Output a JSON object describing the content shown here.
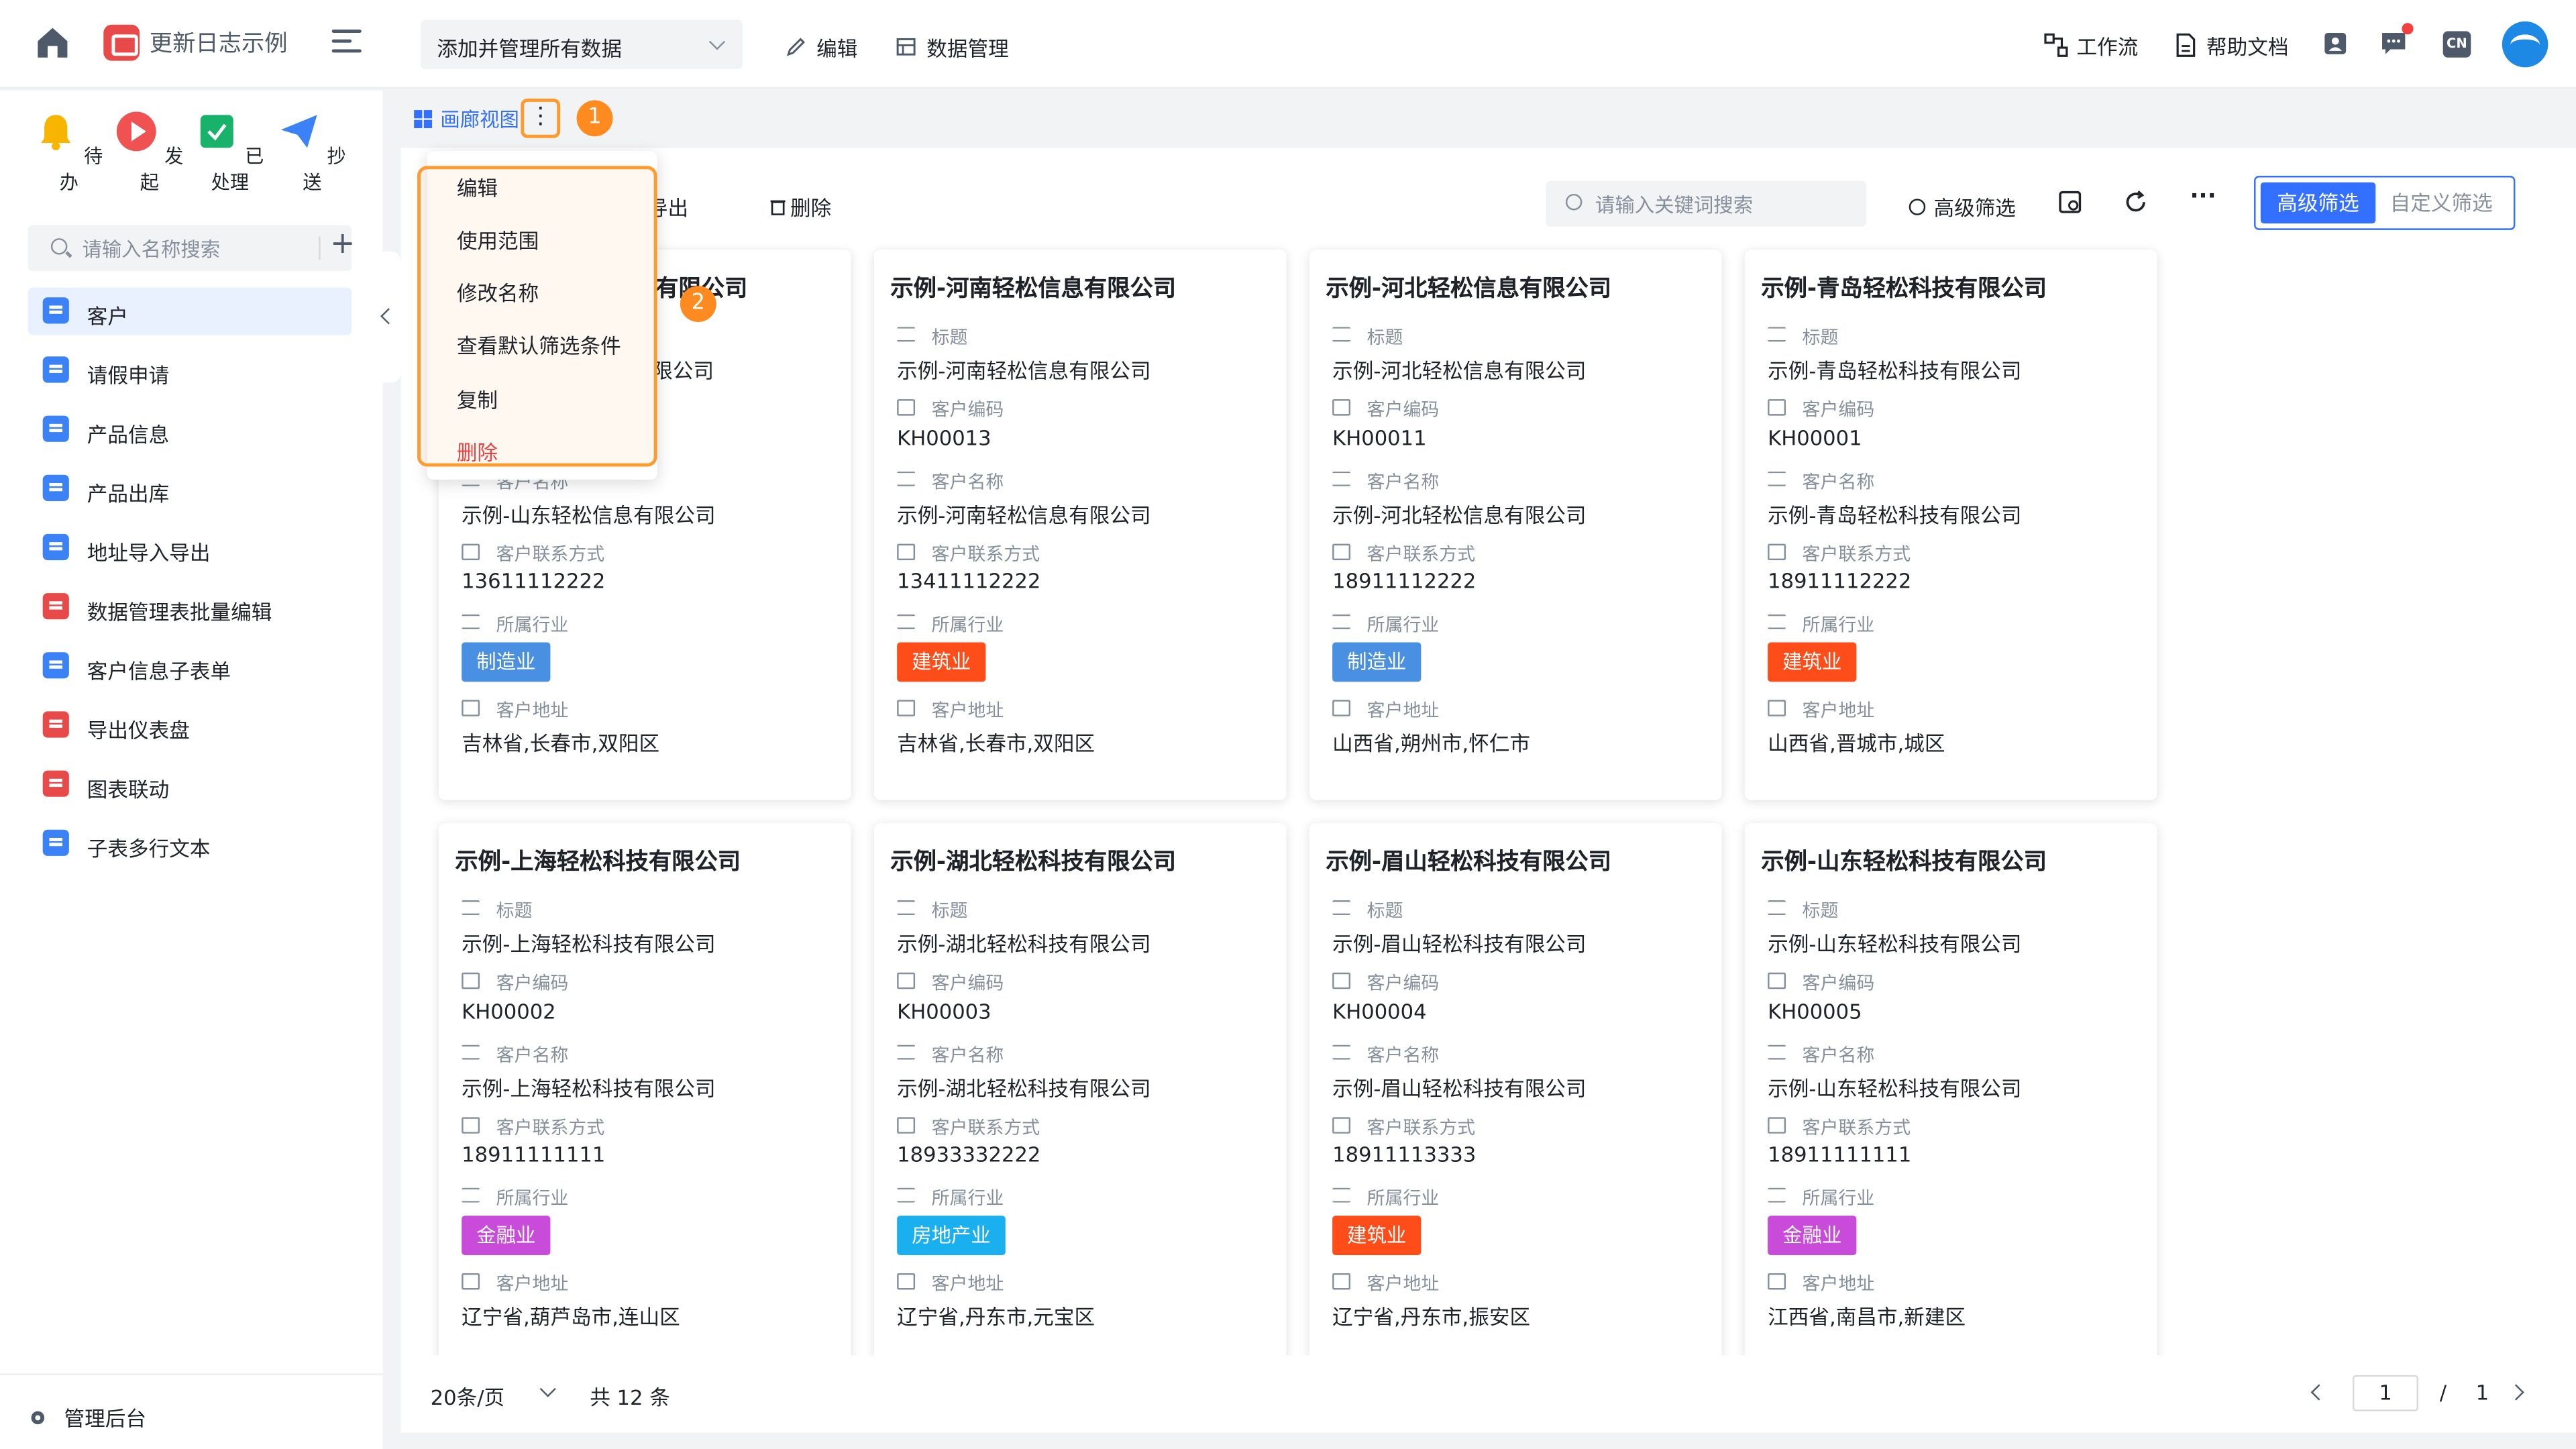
{
  "header": {
    "app_title": "更新日志示例",
    "dataset": "添加并管理所有数据",
    "edit": "编辑",
    "data_manage": "数据管理",
    "workflow": "工作流",
    "help": "帮助文档",
    "lang": "CN"
  },
  "sidebar": {
    "quick": [
      {
        "label": "待办",
        "icon": "bell-icon",
        "color": "#f7b500"
      },
      {
        "label": "发起",
        "icon": "play-icon",
        "color": "#f05252"
      },
      {
        "label": "已处理",
        "icon": "check-doc-icon",
        "color": "#19b26b"
      },
      {
        "label": "抄送",
        "icon": "send-icon",
        "color": "#3b82f6"
      }
    ],
    "search_placeholder": "请输入名称搜索",
    "items": [
      {
        "label": "客户",
        "color": "blue",
        "active": true
      },
      {
        "label": "请假申请",
        "color": "blue"
      },
      {
        "label": "产品信息",
        "color": "blue"
      },
      {
        "label": "产品出库",
        "color": "blue"
      },
      {
        "label": "地址导入导出",
        "color": "blue"
      },
      {
        "label": "数据管理表批量编辑",
        "color": "red"
      },
      {
        "label": "客户信息子表单",
        "color": "blue"
      },
      {
        "label": "导出仪表盘",
        "color": "red"
      },
      {
        "label": "图表联动",
        "color": "red"
      },
      {
        "label": "子表多行文本",
        "color": "blue"
      }
    ],
    "admin": "管理后台"
  },
  "view": {
    "tab_label": "画廊视图",
    "badge1": "1",
    "badge2": "2"
  },
  "dropdown": [
    "编辑",
    "使用范围",
    "修改名称",
    "查看默认筛选条件",
    "复制",
    "删除"
  ],
  "toolbar": {
    "export": "导出",
    "delete": "删除",
    "search_placeholder": "请输入关键词搜索",
    "advanced_filter": "高级筛选",
    "seg_on": "高级筛选",
    "seg_off": "自定义筛选",
    "more": "···"
  },
  "field_labels": {
    "title": "标题",
    "code": "客户编码",
    "name": "客户名称",
    "contact": "客户联系方式",
    "industry": "所属行业",
    "address": "客户地址"
  },
  "cards": [
    {
      "title": "示例-山东轻松信息有限公司",
      "title_visible": "有限公司",
      "name_partial": "限公司",
      "contact": "13611112222",
      "industry": "制造业",
      "tag_color": "#4a90e2",
      "address": "吉林省,长春市,双阳区",
      "name": "示例-山东轻松信息有限公司"
    },
    {
      "title": "示例-河南轻松信息有限公司",
      "name": "示例-河南轻松信息有限公司",
      "code": "KH00013",
      "contact": "13411112222",
      "industry": "建筑业",
      "tag_color": "#ff4d1a",
      "address": "吉林省,长春市,双阳区"
    },
    {
      "title": "示例-河北轻松信息有限公司",
      "name": "示例-河北轻松信息有限公司",
      "code": "KH00011",
      "contact": "18911112222",
      "industry": "制造业",
      "tag_color": "#4a90e2",
      "address": "山西省,朔州市,怀仁市"
    },
    {
      "title": "示例-青岛轻松科技有限公司",
      "name": "示例-青岛轻松科技有限公司",
      "code": "KH00001",
      "contact": "18911112222",
      "industry": "建筑业",
      "tag_color": "#ff4d1a",
      "address": "山西省,晋城市,城区"
    },
    {
      "title": "示例-上海轻松科技有限公司",
      "name": "示例-上海轻松科技有限公司",
      "code": "KH00002",
      "contact": "18911111111",
      "industry": "金融业",
      "tag_color": "#c84bd9",
      "address": "辽宁省,葫芦岛市,连山区"
    },
    {
      "title": "示例-湖北轻松科技有限公司",
      "name": "示例-湖北轻松科技有限公司",
      "code": "KH00003",
      "contact": "18933332222",
      "industry": "房地产业",
      "tag_color": "#1ab0f0",
      "address": "辽宁省,丹东市,元宝区"
    },
    {
      "title": "示例-眉山轻松科技有限公司",
      "name": "示例-眉山轻松科技有限公司",
      "code": "KH00004",
      "contact": "18911113333",
      "industry": "建筑业",
      "tag_color": "#ff4d1a",
      "address": "辽宁省,丹东市,振安区"
    },
    {
      "title": "示例-山东轻松科技有限公司",
      "name": "示例-山东轻松科技有限公司",
      "code": "KH00005",
      "contact": "18911111111",
      "industry": "金融业",
      "tag_color": "#c84bd9",
      "address": "江西省,南昌市,新建区"
    }
  ],
  "pagination": {
    "page_size": "20条/页",
    "total": "共 12 条",
    "current": "1",
    "slash": "/",
    "pages": "1"
  }
}
